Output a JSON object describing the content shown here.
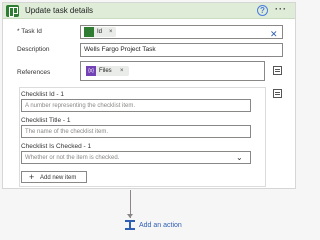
{
  "header": {
    "title": "Update task details",
    "help_glyph": "?",
    "more_glyph": "···"
  },
  "fields": {
    "task_id": {
      "label": "* Task Id",
      "token": "Id",
      "close": "×",
      "clear": "✕"
    },
    "description": {
      "label": "Description",
      "value": "Wells Fargo Project Task"
    },
    "references": {
      "label": "References",
      "token_icon": "{x}",
      "token": "Files",
      "close": "×"
    }
  },
  "checklist": {
    "id_label": "Checklist Id - 1",
    "id_placeholder": "A number representing the checklist item.",
    "title_label": "Checklist Title - 1",
    "title_placeholder": "The name of the checklist item.",
    "checked_label": "Checklist Is Checked - 1",
    "checked_placeholder": "Whether or not the item is checked.",
    "chevron": "⌄",
    "add_new_item": "Add new item",
    "plus": "+"
  },
  "footer": {
    "add_action": "Add an action"
  },
  "colors": {
    "header_bg": "#deecd8",
    "accent": "#2f5fb3",
    "planner_green": "#2e7d32",
    "expr_purple": "#7342b5"
  },
  "icons": [
    "planner-icon",
    "help-icon",
    "more-icon",
    "clear-icon",
    "switch-input-mode-icon",
    "add-action-icon"
  ]
}
